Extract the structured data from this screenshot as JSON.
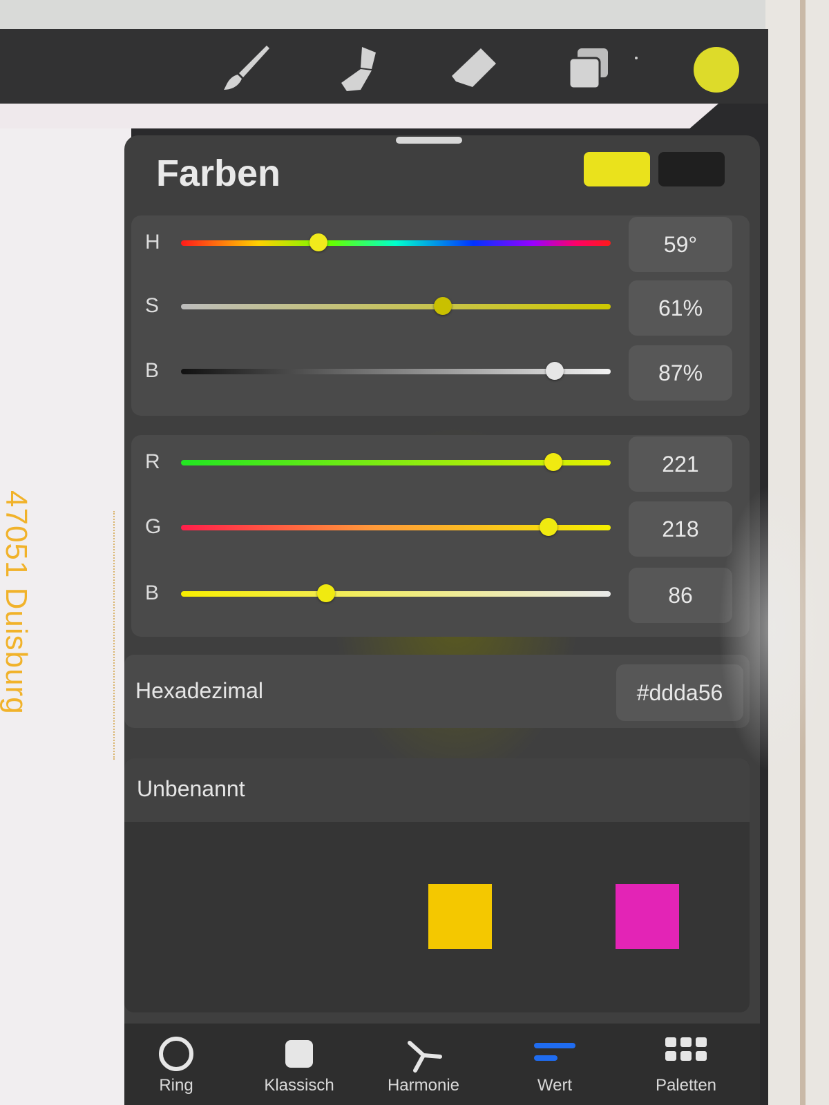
{
  "canvas": {
    "rotated_text": "47051 Duisburg"
  },
  "toolbar": {
    "tools": [
      {
        "icon": "brush-icon"
      },
      {
        "icon": "smudge-icon"
      },
      {
        "icon": "eraser-icon"
      },
      {
        "icon": "layers-icon"
      }
    ],
    "current_color": "#dddb2a"
  },
  "panel": {
    "title": "Farben",
    "primary_swatch": "#eae21c",
    "secondary_swatch": "#1f1f1f",
    "hsb": [
      {
        "label": "H",
        "value": "59°",
        "level": 0.32
      },
      {
        "label": "S",
        "value": "61%",
        "level": 0.61
      },
      {
        "label": "B",
        "value": "87%",
        "level": 0.87
      }
    ],
    "rgb": [
      {
        "label": "R",
        "value": "221",
        "level": 0.867
      },
      {
        "label": "G",
        "value": "218",
        "level": 0.855
      },
      {
        "label": "B",
        "value": "86",
        "level": 0.337
      }
    ],
    "hex_label": "Hexadezimal",
    "hex_value": "#ddda56",
    "palette_title": "Unbenannt",
    "palette_swatches": [
      "#f4c800",
      "#e324b6"
    ]
  },
  "tabs": [
    {
      "label": "Ring",
      "icon": "ring-icon"
    },
    {
      "label": "Klassisch",
      "icon": "square-icon"
    },
    {
      "label": "Harmonie",
      "icon": "harmony-icon"
    },
    {
      "label": "Wert",
      "icon": "value-sliders-icon",
      "active": true
    },
    {
      "label": "Paletten",
      "icon": "grid-icon"
    }
  ]
}
